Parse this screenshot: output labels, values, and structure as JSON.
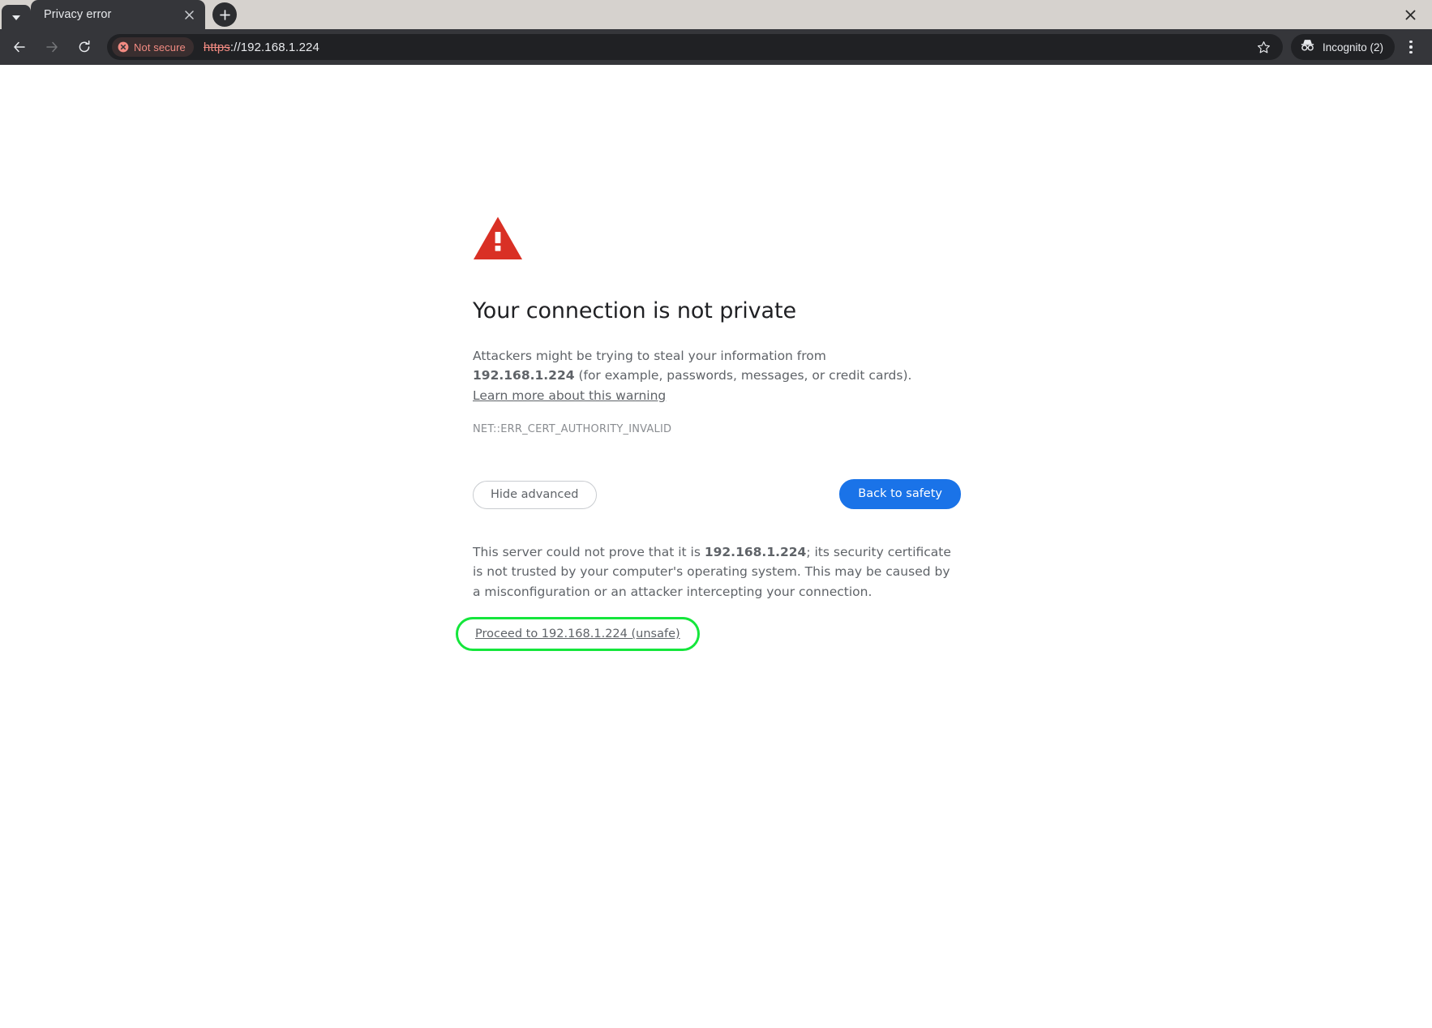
{
  "window": {
    "close_label": "✕"
  },
  "tabstrip": {
    "tab_search_icon": "chevron-down-icon",
    "tabs": [
      {
        "title": "Privacy error",
        "active": true,
        "close_icon": "close-icon"
      }
    ],
    "new_tab_label": "+"
  },
  "toolbar": {
    "back_icon": "arrow-left-icon",
    "forward_icon": "arrow-right-icon",
    "reload_icon": "reload-icon",
    "security_chip": {
      "icon": "not-secure-icon",
      "label": "Not secure",
      "color": "#f28b82"
    },
    "url": {
      "scheme": "https",
      "rest": "://192.168.1.224",
      "full": "https://192.168.1.224"
    },
    "bookmark_icon": "star-icon",
    "incognito": {
      "icon": "incognito-icon",
      "label": "Incognito (2)"
    },
    "menu_icon": "three-dot-menu-icon"
  },
  "page": {
    "warning_icon": "warning-triangle-icon",
    "warning_color": "#d93025",
    "heading": "Your connection is not private",
    "paragraph": {
      "before_host": "Attackers might be trying to steal your information from ",
      "host": "192.168.1.224",
      "after_host": " (for example, passwords, messages, or credit cards). ",
      "learn_more": "Learn more about this warning"
    },
    "error_code": "NET::ERR_CERT_AUTHORITY_INVALID",
    "buttons": {
      "advanced": "Hide advanced",
      "back_to_safety": "Back to safety",
      "primary_color": "#1a73e8"
    },
    "advanced": {
      "before_host": "This server could not prove that it is ",
      "host": "192.168.1.224",
      "after_host": "; its security certificate is not trusted by your computer's operating system. This may be caused by a misconfiguration or an attacker intercepting your connection.",
      "proceed_link": "Proceed to 192.168.1.224 (unsafe)",
      "highlight_color": "#15e63c"
    }
  }
}
